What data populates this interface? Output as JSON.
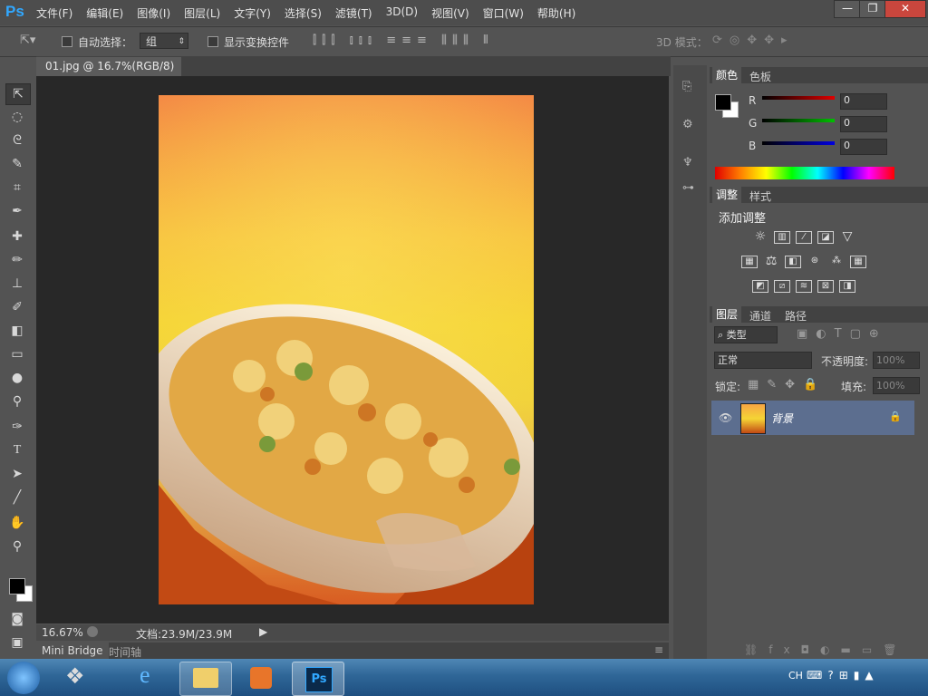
{
  "app": {
    "logo": "Ps"
  },
  "menu": [
    "文件(F)",
    "编辑(E)",
    "图像(I)",
    "图层(L)",
    "文字(Y)",
    "选择(S)",
    "滤镜(T)",
    "3D(D)",
    "视图(V)",
    "窗口(W)",
    "帮助(H)"
  ],
  "window_controls": {
    "minimize": "—",
    "restore": "❐",
    "close": "✕"
  },
  "options": {
    "auto_select_label": "自动选择：",
    "auto_select_value": "组",
    "show_transform_label": "显示变换控件",
    "mode_3d_label": "3D 模式："
  },
  "document": {
    "tab_title": "01.jpg @ 16.7%(RGB/8)",
    "tab_close": "×",
    "zoom": "16.67%",
    "doc_info": "文档:23.9M/23.9M"
  },
  "bottom_tabs": [
    "Mini Bridge",
    "时间轴"
  ],
  "color_panel": {
    "tabs": [
      "颜色",
      "色板"
    ],
    "channels": [
      {
        "label": "R",
        "value": "0",
        "color": "#e00000"
      },
      {
        "label": "G",
        "value": "0",
        "color": "#00c000"
      },
      {
        "label": "B",
        "value": "0",
        "color": "#0000e0"
      }
    ]
  },
  "adjust_panel": {
    "tabs": [
      "调整",
      "样式"
    ],
    "title": "添加调整"
  },
  "layers_panel": {
    "tabs": [
      "图层",
      "通道",
      "路径"
    ],
    "filter_label": "类型",
    "blend_mode": "正常",
    "opacity_label": "不透明度:",
    "opacity_value": "100%",
    "lock_label": "锁定:",
    "fill_label": "填充:",
    "fill_value": "100%",
    "layers": [
      {
        "name": "背景",
        "visible": true,
        "locked": true
      }
    ]
  },
  "taskbar": {
    "lang": "CH"
  }
}
